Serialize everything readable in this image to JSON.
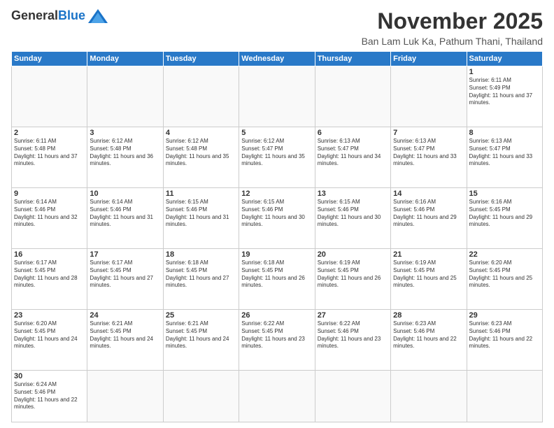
{
  "logo": {
    "general": "General",
    "blue": "Blue"
  },
  "title": {
    "month_year": "November 2025",
    "location": "Ban Lam Luk Ka, Pathum Thani, Thailand"
  },
  "days_of_week": [
    "Sunday",
    "Monday",
    "Tuesday",
    "Wednesday",
    "Thursday",
    "Friday",
    "Saturday"
  ],
  "weeks": [
    [
      {
        "day": null
      },
      {
        "day": null
      },
      {
        "day": null
      },
      {
        "day": null
      },
      {
        "day": null
      },
      {
        "day": null
      },
      {
        "day": 1,
        "sunrise": "6:11 AM",
        "sunset": "5:49 PM",
        "daylight": "11 hours and 37 minutes."
      }
    ],
    [
      {
        "day": 2,
        "sunrise": "6:11 AM",
        "sunset": "5:48 PM",
        "daylight": "11 hours and 37 minutes."
      },
      {
        "day": 3,
        "sunrise": "6:12 AM",
        "sunset": "5:48 PM",
        "daylight": "11 hours and 36 minutes."
      },
      {
        "day": 4,
        "sunrise": "6:12 AM",
        "sunset": "5:48 PM",
        "daylight": "11 hours and 35 minutes."
      },
      {
        "day": 5,
        "sunrise": "6:12 AM",
        "sunset": "5:47 PM",
        "daylight": "11 hours and 35 minutes."
      },
      {
        "day": 6,
        "sunrise": "6:13 AM",
        "sunset": "5:47 PM",
        "daylight": "11 hours and 34 minutes."
      },
      {
        "day": 7,
        "sunrise": "6:13 AM",
        "sunset": "5:47 PM",
        "daylight": "11 hours and 33 minutes."
      },
      {
        "day": 8,
        "sunrise": "6:13 AM",
        "sunset": "5:47 PM",
        "daylight": "11 hours and 33 minutes."
      }
    ],
    [
      {
        "day": 9,
        "sunrise": "6:14 AM",
        "sunset": "5:46 PM",
        "daylight": "11 hours and 32 minutes."
      },
      {
        "day": 10,
        "sunrise": "6:14 AM",
        "sunset": "5:46 PM",
        "daylight": "11 hours and 31 minutes."
      },
      {
        "day": 11,
        "sunrise": "6:15 AM",
        "sunset": "5:46 PM",
        "daylight": "11 hours and 31 minutes."
      },
      {
        "day": 12,
        "sunrise": "6:15 AM",
        "sunset": "5:46 PM",
        "daylight": "11 hours and 30 minutes."
      },
      {
        "day": 13,
        "sunrise": "6:15 AM",
        "sunset": "5:46 PM",
        "daylight": "11 hours and 30 minutes."
      },
      {
        "day": 14,
        "sunrise": "6:16 AM",
        "sunset": "5:46 PM",
        "daylight": "11 hours and 29 minutes."
      },
      {
        "day": 15,
        "sunrise": "6:16 AM",
        "sunset": "5:45 PM",
        "daylight": "11 hours and 29 minutes."
      }
    ],
    [
      {
        "day": 16,
        "sunrise": "6:17 AM",
        "sunset": "5:45 PM",
        "daylight": "11 hours and 28 minutes."
      },
      {
        "day": 17,
        "sunrise": "6:17 AM",
        "sunset": "5:45 PM",
        "daylight": "11 hours and 27 minutes."
      },
      {
        "day": 18,
        "sunrise": "6:18 AM",
        "sunset": "5:45 PM",
        "daylight": "11 hours and 27 minutes."
      },
      {
        "day": 19,
        "sunrise": "6:18 AM",
        "sunset": "5:45 PM",
        "daylight": "11 hours and 26 minutes."
      },
      {
        "day": 20,
        "sunrise": "6:19 AM",
        "sunset": "5:45 PM",
        "daylight": "11 hours and 26 minutes."
      },
      {
        "day": 21,
        "sunrise": "6:19 AM",
        "sunset": "5:45 PM",
        "daylight": "11 hours and 25 minutes."
      },
      {
        "day": 22,
        "sunrise": "6:20 AM",
        "sunset": "5:45 PM",
        "daylight": "11 hours and 25 minutes."
      }
    ],
    [
      {
        "day": 23,
        "sunrise": "6:20 AM",
        "sunset": "5:45 PM",
        "daylight": "11 hours and 24 minutes."
      },
      {
        "day": 24,
        "sunrise": "6:21 AM",
        "sunset": "5:45 PM",
        "daylight": "11 hours and 24 minutes."
      },
      {
        "day": 25,
        "sunrise": "6:21 AM",
        "sunset": "5:45 PM",
        "daylight": "11 hours and 24 minutes."
      },
      {
        "day": 26,
        "sunrise": "6:22 AM",
        "sunset": "5:45 PM",
        "daylight": "11 hours and 23 minutes."
      },
      {
        "day": 27,
        "sunrise": "6:22 AM",
        "sunset": "5:46 PM",
        "daylight": "11 hours and 23 minutes."
      },
      {
        "day": 28,
        "sunrise": "6:23 AM",
        "sunset": "5:46 PM",
        "daylight": "11 hours and 22 minutes."
      },
      {
        "day": 29,
        "sunrise": "6:23 AM",
        "sunset": "5:46 PM",
        "daylight": "11 hours and 22 minutes."
      }
    ],
    [
      {
        "day": 30,
        "sunrise": "6:24 AM",
        "sunset": "5:46 PM",
        "daylight": "11 hours and 22 minutes."
      },
      {
        "day": null
      },
      {
        "day": null
      },
      {
        "day": null
      },
      {
        "day": null
      },
      {
        "day": null
      },
      {
        "day": null
      }
    ]
  ]
}
